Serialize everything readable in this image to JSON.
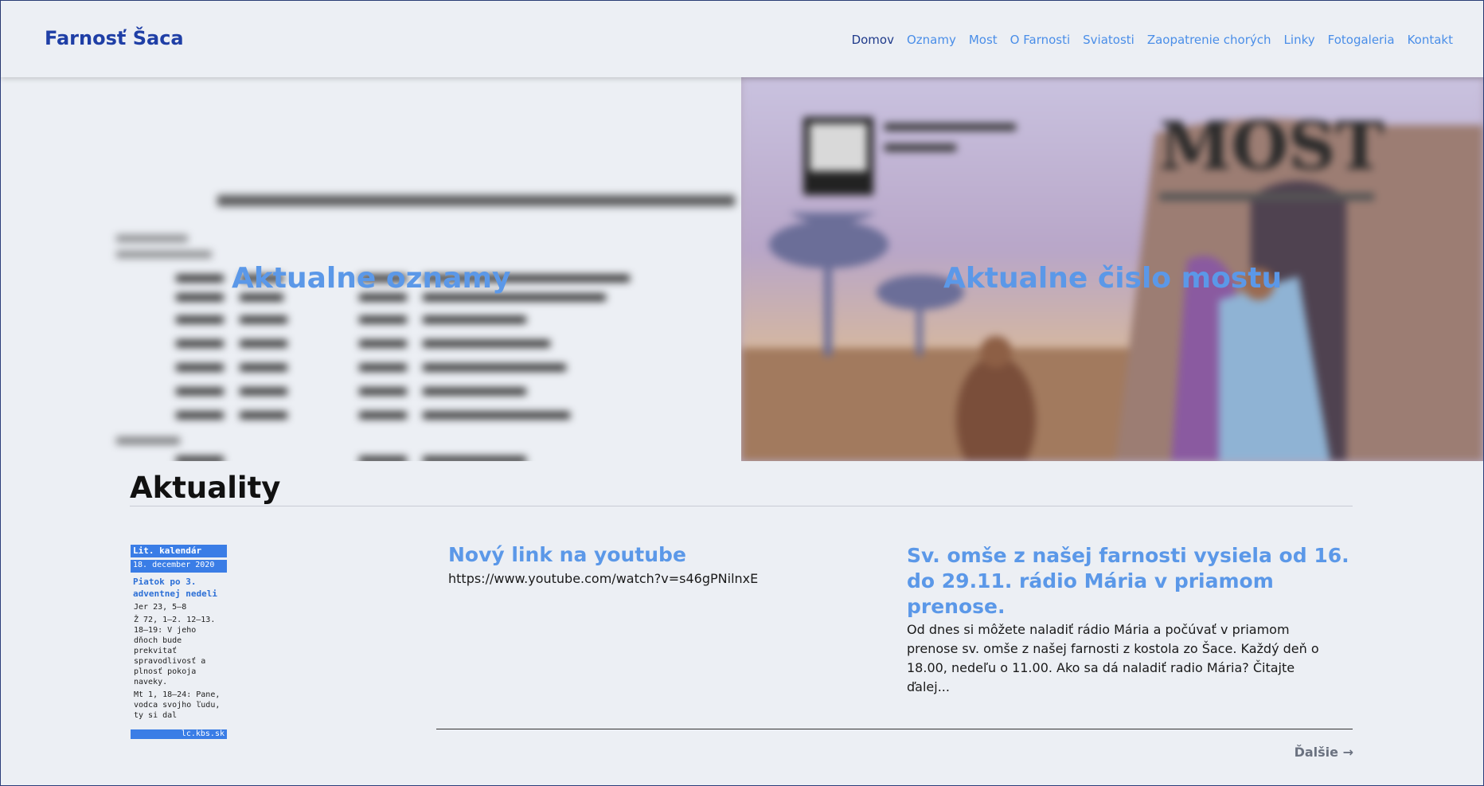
{
  "header": {
    "brand": "Farnosť Šaca",
    "nav": [
      "Domov",
      "Oznamy",
      "Most",
      "O Farnosti",
      "Sviatosti",
      "Zaopatrenie chorých",
      "Linky",
      "Fotogaleria",
      "Kontakt"
    ]
  },
  "hero": {
    "left_title": "Aktualne oznamy",
    "right_title": "Aktualne čislo mostu",
    "right_logo": "MOST"
  },
  "aktuality": {
    "heading": "Aktuality"
  },
  "calendar": {
    "header": "Lit. kalendár",
    "date": "18. december 2020",
    "title": "Piatok po 3. adventnej nedeli",
    "reading1": "Jer 23, 5–8",
    "psalm": "Ž 72, 1–2. 12–13. 18–19: V jeho dňoch bude prekvitať spravodlivosť a plnosť pokoja naveky.",
    "gospel": "Mt 1, 18–24: Pane, vodca svojho ľudu, ty si dal",
    "footer": "lc.kbs.sk"
  },
  "news": [
    {
      "title": "Nový link na youtube",
      "body": "https://www.youtube.com/watch?v=s46gPNilnxE"
    },
    {
      "title": "Sv. omše z našej farnosti vysiela od 16. do 29.11. rádio Mária v priamom prenose.",
      "body": "Od dnes si môžete naladiť rádio Mária a počúvať v priamom prenose sv. omše z našej farnosti z kostola zo Šace. Každý deň o 18.00, nedeľu o 11.00. Ako sa dá naladiť radio Mária? Čitajte ďalej..."
    }
  ],
  "more_link": "Ďalšie →",
  "colors": {
    "accent": "#5b98e8",
    "brand": "#1f3fa6",
    "calendar": "#3a7de6"
  }
}
